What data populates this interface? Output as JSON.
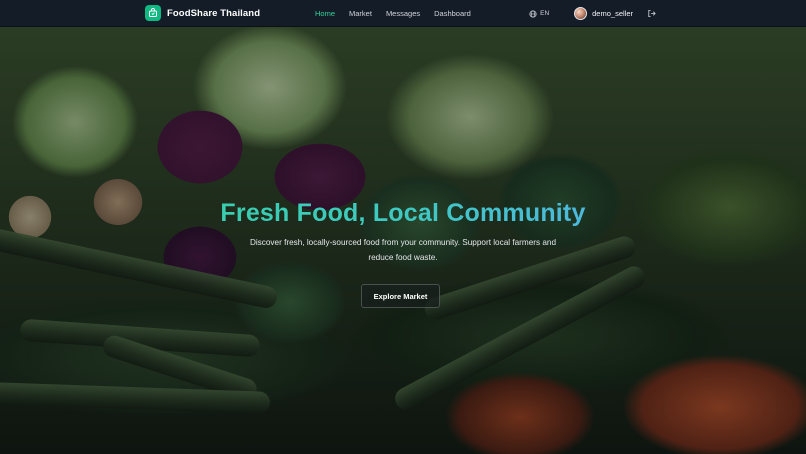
{
  "nav": {
    "brand": "FoodShare Thailand",
    "links": [
      {
        "label": "Home",
        "active": true
      },
      {
        "label": "Market",
        "active": false
      },
      {
        "label": "Messages",
        "active": false
      },
      {
        "label": "Dashboard",
        "active": false
      }
    ],
    "language": "EN",
    "username": "demo_seller",
    "icons": {
      "brand": "basket-icon",
      "language": "globe-icon",
      "logout": "logout-icon"
    }
  },
  "hero": {
    "title": "Fresh Food, Local Community",
    "subtitle": "Discover fresh, locally-sourced food from your community. Support local farmers and reduce food waste.",
    "cta_label": "Explore Market"
  },
  "colors": {
    "accent": "#10b981",
    "title_gradient_start": "#34d399",
    "title_gradient_end": "#60a5fa",
    "nav_background": "#141c27"
  }
}
